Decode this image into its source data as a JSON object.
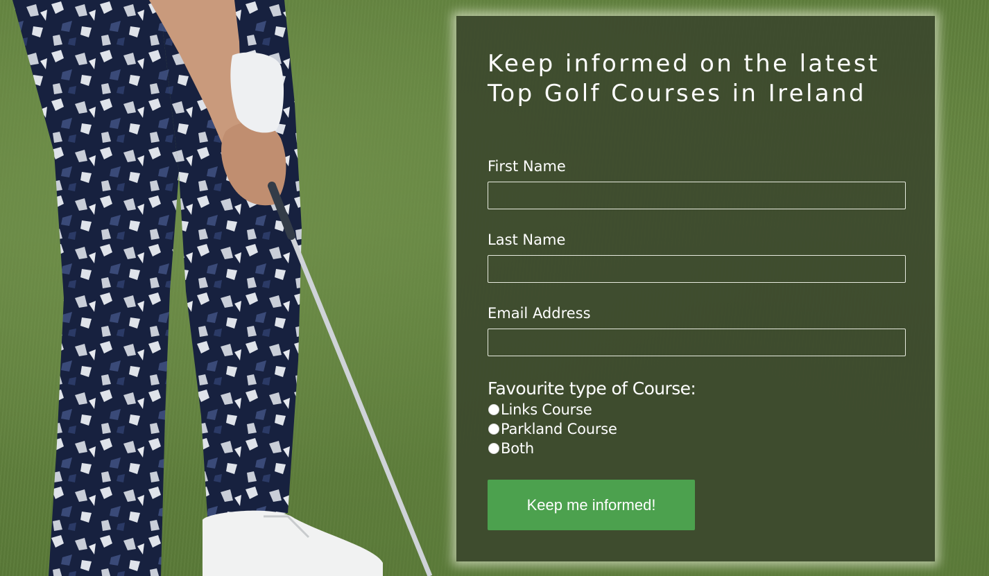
{
  "form": {
    "title": "Keep informed on the latest Top Golf Courses in Ireland",
    "fields": [
      {
        "label": "First Name",
        "value": "",
        "placeholder": ""
      },
      {
        "label": "Last Name",
        "value": "",
        "placeholder": ""
      },
      {
        "label": "Email Address",
        "value": "",
        "placeholder": ""
      }
    ],
    "course_question": "Favourite type of Course:",
    "course_options": [
      "Links Course",
      "Parkland Course",
      "Both"
    ],
    "submit_label": "Keep me informed!"
  },
  "colors": {
    "card_background": "#3a462c",
    "submit_button": "#4ca14e",
    "grass": "#5f7f3c",
    "trousers": "#17213f"
  }
}
